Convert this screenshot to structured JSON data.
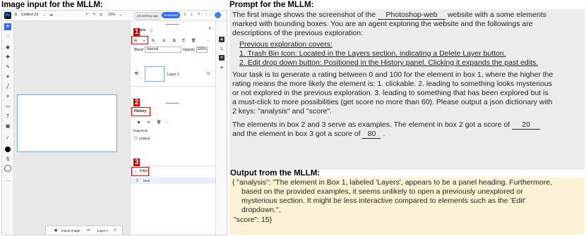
{
  "headers": {
    "left": "Image input for the MLLM:",
    "prompt": "Prompt for the MLLM:",
    "output": "Output from the MLLM:"
  },
  "screenshot": {
    "app_logo": "Ps",
    "doc_title": "Untitled (0)",
    "zoom": "23%",
    "url_pill": "photoshop.app",
    "download_label": "Download",
    "layers_title": "Layers",
    "blend_label": "Blend",
    "blend_value": "Normal",
    "opacity_label": "Opacity",
    "opacity_value": "100%",
    "layer_name": "Layer 1",
    "history_title": "History",
    "snapshots_label": "Snapshots",
    "untitled_label": "Untitled",
    "edits_label": "Edits",
    "new_label": "New",
    "import_label": "Import image",
    "bottom_layer": "Layer 1",
    "box_numbers": [
      "1",
      "2",
      "3"
    ]
  },
  "prompt": {
    "l1a": "The first image shows the screenshot of the",
    "site": "Photoshop-web",
    "l1b": "website with a some elements",
    "l2": "marked with bounding boxes. You are an agent exploring the website and the followings are",
    "l3": "descriptions of the previous exploration:",
    "prev_header": "Previous exploration covers:",
    "prev1": "1. Trash Bin Icon: Located in the Layers section, indicating a Delete Layer button.",
    "prev2": "2. Edit drop down button: Positioned in the History panel. Clicking it expands the past edits.",
    "t1": "Your task is to generate a rating between 0 and 100 for the element in box 1, where the higher the",
    "t2": "rating means the more likely the element is: 1. clickable. 2. leading to something looks mysterious",
    "t3": "or not explored in the previous exploration. 3. leading to something that has been explored but is",
    "t4": "a must-click to more possibilities (get score no more than 60). Please output a json dictionary with",
    "t5": "2 keys: \"analysis\" and \"score\".",
    "e1a": "The elements in box 2 and 3 serve as examples. The element in box 2 got a score of",
    "score2": "20",
    "e2a": "and the element in box 3 got a score of",
    "score3": "80",
    "e2b": "."
  },
  "output": {
    "o1": "{ \"analysis\": \"The element in Box 1, labeled 'Layers', appears to be a panel heading. Furthermore,",
    "o2": "based on the provided examples, it seems unlikely to open a previously unexplored or",
    "o3": "mysterious section. It might be less interactive compared to elements such as the 'Edit'",
    "o4": "dropdown.\",",
    "o5": "\"score\": 15}"
  },
  "colors": {
    "accent_red": "#cc0000",
    "prompt_bg": "#ececec",
    "output_bg": "#fdf3d4",
    "download_blue": "#2c6cf0"
  }
}
